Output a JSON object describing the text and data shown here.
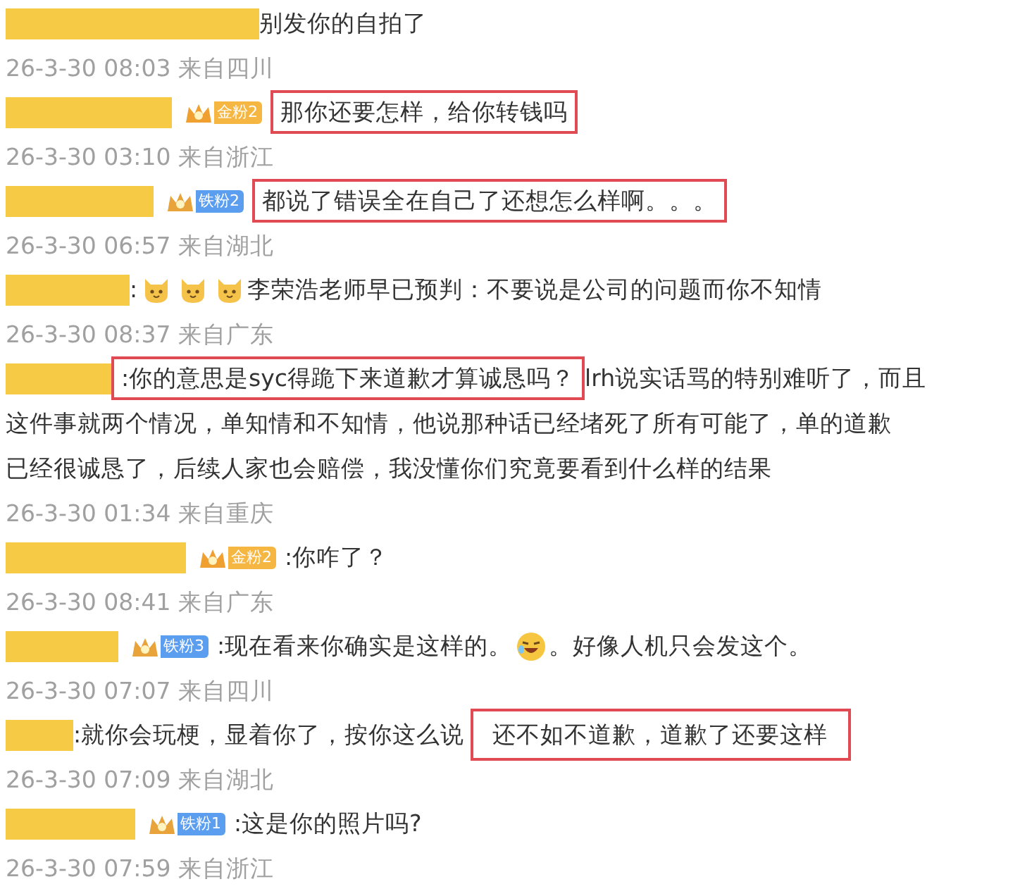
{
  "comments": [
    {
      "segments": [
        {
          "kind": "text",
          "text": "别发你的自拍了",
          "boxed": false
        }
      ],
      "meta": "26-3-30 08:03 来自四川"
    },
    {
      "badge": {
        "kind": "gold",
        "label": "金粉2"
      },
      "segments": [
        {
          "kind": "text",
          "text": "那你还要怎样，给你转钱吗",
          "boxed": true
        }
      ],
      "meta": "26-3-30 03:10 来自浙江"
    },
    {
      "badge": {
        "kind": "iron",
        "label": "铁粉2"
      },
      "segments": [
        {
          "kind": "text",
          "text": "都说了错误全在自己了还想怎么样啊。。。",
          "boxed": true
        }
      ],
      "meta": "26-3-30 06:57 来自湖北"
    },
    {
      "segments": [
        {
          "kind": "text",
          "text": ":",
          "boxed": false
        },
        {
          "kind": "cat"
        },
        {
          "kind": "cat"
        },
        {
          "kind": "cat"
        },
        {
          "kind": "text",
          "text": "李荣浩老师早已预判：不要说是公司的问题而你不知情",
          "boxed": false
        }
      ],
      "meta": "26-3-30 08:37 来自广东"
    },
    {
      "segments": [
        {
          "kind": "text",
          "text": ":你的意思是syc得跪下来道歉才算诚恳吗？",
          "boxed": true
        },
        {
          "kind": "text",
          "text": "lrh说实话骂的特别难听了，而且",
          "boxed": false
        },
        {
          "kind": "text",
          "text": "这件事就两个情况，单知情和不知情，他说那种话已经堵死了所有可能了，单的道歉",
          "boxed": false,
          "newline": true
        },
        {
          "kind": "text",
          "text": "已经很诚恳了，后续人家也会赔偿，我没懂你们究竟要看到什么样的结果",
          "boxed": false,
          "newline": true
        }
      ],
      "meta": "26-3-30 01:34 来自重庆"
    },
    {
      "badge": {
        "kind": "gold",
        "label": "金粉2"
      },
      "segments": [
        {
          "kind": "text",
          "text": ":你咋了？",
          "boxed": false
        }
      ],
      "meta": "26-3-30 08:41 来自广东"
    },
    {
      "badge": {
        "kind": "iron",
        "label": "铁粉3"
      },
      "segments": [
        {
          "kind": "text",
          "text": ":现在看来你确实是这样的。",
          "boxed": false
        },
        {
          "kind": "laugh"
        },
        {
          "kind": "text",
          "text": "。好像人机只会发这个。",
          "boxed": false
        }
      ],
      "meta": "26-3-30 07:07 来自四川"
    },
    {
      "segments": [
        {
          "kind": "text",
          "text": ":就你会玩梗，显着你了，按你这么说",
          "boxed": false
        },
        {
          "kind": "text",
          "text": "还不如不道歉，道歉了还要这样",
          "boxed": true
        }
      ],
      "meta": "26-3-30 07:09 来自湖北"
    },
    {
      "badge": {
        "kind": "iron",
        "label": "铁粉1"
      },
      "segments": [
        {
          "kind": "text",
          "text": ":这是你的照片吗?",
          "boxed": false
        }
      ],
      "meta": "26-3-30 07:59 来自浙江"
    }
  ]
}
